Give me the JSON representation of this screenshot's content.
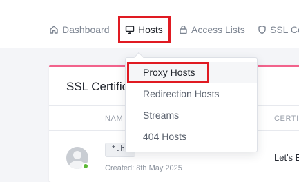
{
  "nav": {
    "items": [
      {
        "label": "Dashboard",
        "icon": "home-icon"
      },
      {
        "label": "Hosts",
        "icon": "monitor-icon",
        "active": true
      },
      {
        "label": "Access Lists",
        "icon": "lock-icon"
      },
      {
        "label": "SSL Ce",
        "icon": "shield-icon"
      }
    ]
  },
  "hosts_menu": {
    "items": [
      {
        "label": "Proxy Hosts",
        "active": true
      },
      {
        "label": "Redirection Hosts"
      },
      {
        "label": "Streams"
      },
      {
        "label": "404 Hosts"
      }
    ]
  },
  "card": {
    "title": "SSL Certific",
    "columns": [
      "NAM",
      "CERTI"
    ],
    "row": {
      "host": "*.ho",
      "created": "Created: 8th May 2025",
      "provider": "Let's E",
      "status": "online"
    }
  },
  "colors": {
    "highlight": "#e01a22",
    "card_accent": "#f2638c",
    "status_online": "#5cb836"
  }
}
